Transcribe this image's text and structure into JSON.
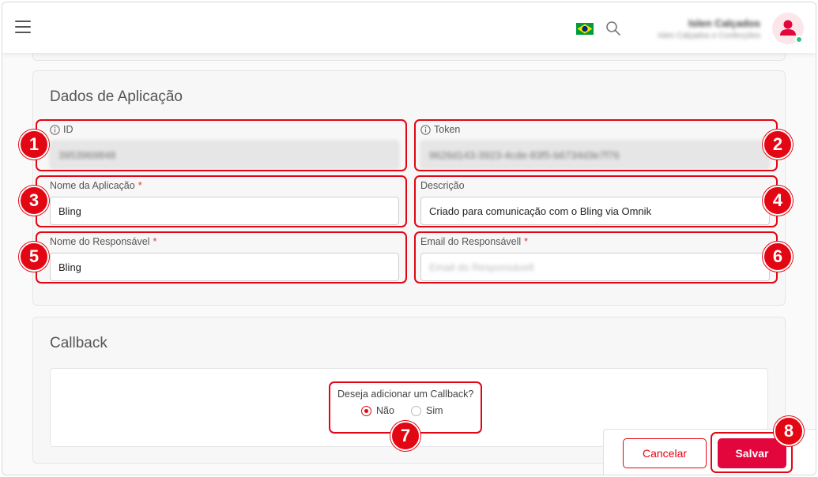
{
  "header": {
    "user_name": "Islen Calçados",
    "user_company": "Islen Calçados e Confecções"
  },
  "app_section": {
    "title": "Dados de Aplicação",
    "id_label": "ID",
    "id_value": "3953969848",
    "token_label": "Token",
    "token_value": "9626d143-3923-4cde-83f5-b6734d3e7f76",
    "app_name_label": "Nome da Aplicação",
    "app_name_value": "Bling",
    "description_label": "Descrição",
    "description_value": "Criado para comunicação com o Bling via Omnik",
    "responsible_name_label": "Nome do Responsável",
    "responsible_name_value": "Bling",
    "responsible_email_label": "Email do Responsávell",
    "responsible_email_placeholder": "Email do Responsávell",
    "required_mark": "*"
  },
  "callback_section": {
    "title": "Callback",
    "question": "Deseja adicionar um Callback?",
    "option_no": "Não",
    "option_yes": "Sim",
    "selected": "Não"
  },
  "actions": {
    "cancel_label": "Cancelar",
    "save_label": "Salvar"
  },
  "annotations": {
    "b1": "1",
    "b2": "2",
    "b3": "3",
    "b4": "4",
    "b5": "5",
    "b6": "6",
    "b7": "7",
    "b8": "8"
  },
  "colors": {
    "accent": "#e30613",
    "save_button": "#e3063c",
    "online": "#2ec27e"
  }
}
